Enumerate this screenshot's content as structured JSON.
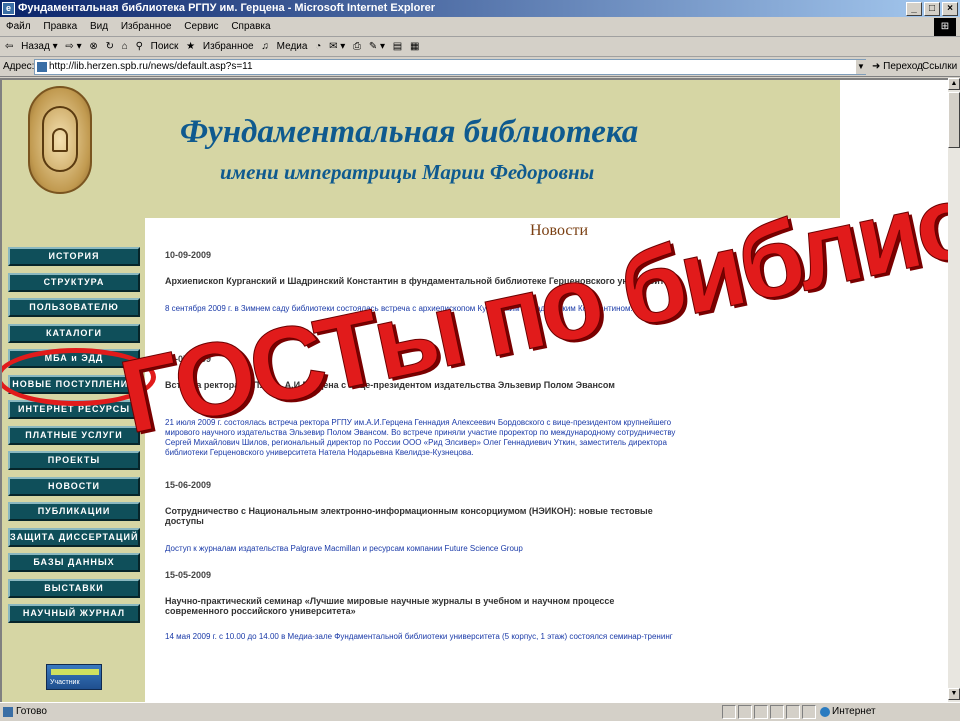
{
  "window": {
    "title": "Фундаментальная библиотека РГПУ им. Герцена - Microsoft Internet Explorer",
    "controls": {
      "minimize": "_",
      "maximize": "□",
      "close": "×"
    }
  },
  "menu": [
    "Файл",
    "Правка",
    "Вид",
    "Избранное",
    "Сервис",
    "Справка"
  ],
  "toolbar": {
    "back": "Назад",
    "search": "Поиск",
    "favorites": "Избранное",
    "media": "Медиа"
  },
  "address": {
    "label": "Адрес:",
    "url": "http://lib.herzen.spb.ru/news/default.asp?s=11",
    "go": "Переход",
    "links": "Ссылки"
  },
  "site": {
    "title": "Фундаментальная библиотека",
    "subtitle": "имени императрицы Марии Федоровны",
    "news_heading": "Новости"
  },
  "nav": [
    "ИСТОРИЯ",
    "СТРУКТУРА",
    "ПОЛЬЗОВАТЕЛЮ",
    "КАТАЛОГИ",
    "МБА и ЭДД",
    "НОВЫЕ ПОСТУПЛЕНИЯ",
    "ИНТЕРНЕТ РЕСУРСЫ",
    "ПЛАТНЫЕ УСЛУГИ",
    "ПРОЕКТЫ",
    "НОВОСТИ",
    "ПУБЛИКАЦИИ",
    "ЗАЩИТА ДИССЕРТАЦИЙ",
    "БАЗЫ ДАННЫХ",
    "ВЫСТАВКИ",
    "НАУЧНЫЙ ЖУРНАЛ"
  ],
  "counter_label": "Участник",
  "news": [
    {
      "date": "10-09-2009"
    },
    {
      "headline": "Архиепископ Курганский и Шадринский Константин в фундаментальной библиотеке Герценовского университета"
    },
    {
      "body": "8 сентября 2009 г. в Зимнем саду библиотеки состоялась встреча с архиепископом Курганским и Шадринским Константином."
    },
    {
      "date": "21-07-2009"
    },
    {
      "headline": "Встреча ректора РГПУ им. А.И.Герцена с вице-президентом издательства Эльзевир Полом Эвансом"
    },
    {
      "body": "21 июля 2009 г. состоялась встреча ректора РГПУ им.А.И.Герцена Геннадия Алексеевич Бордовского с вице-президентом крупнейшего"
    },
    {
      "body": "мирового научного издательства Эльзевир Полом Эвансом. Во встрече приняли участие проректор по международному сотрудничеству"
    },
    {
      "body": "Сергей Михайлович Шилов, региональный директор по России ООО «Рид Элсивер» Олег Геннадиевич Уткин, заместитель директора"
    },
    {
      "body": "библиотеки Герценовского университета Натела Нодарьевна Квелидзе-Кузнецова."
    },
    {
      "date": "15-06-2009"
    },
    {
      "headline": "Сотрудничество с Национальным электронно-информационным консорциумом (НЭИКОН): новые тестовые"
    },
    {
      "headline": "доступы"
    },
    {
      "body": "Доступ к журналам издательства Palgrave Macmillan и ресурсам компании Future Science Group"
    },
    {
      "date": "15-05-2009"
    },
    {
      "headline": "Научно-практический семинар «Лучшие мировые научные журналы в учебном и научном процессе"
    },
    {
      "headline": "современного российского университета»"
    },
    {
      "body": "14 мая 2009 г. с 10.00 до 14.00 в Медиа-зале Фундаментальной библиотеки университета (5 корпус, 1 этаж) состоялся семинар-тренинг"
    }
  ],
  "overlay_text": "ГОСТы по библиографии",
  "status": {
    "ready": "Готово",
    "zone": "Интернет"
  },
  "colors": {
    "header_bg": "#d6d6a4",
    "nav_bg": "#0f4f5a",
    "title_color": "#0f5a8f",
    "overlay_red": "#e11b1b"
  }
}
